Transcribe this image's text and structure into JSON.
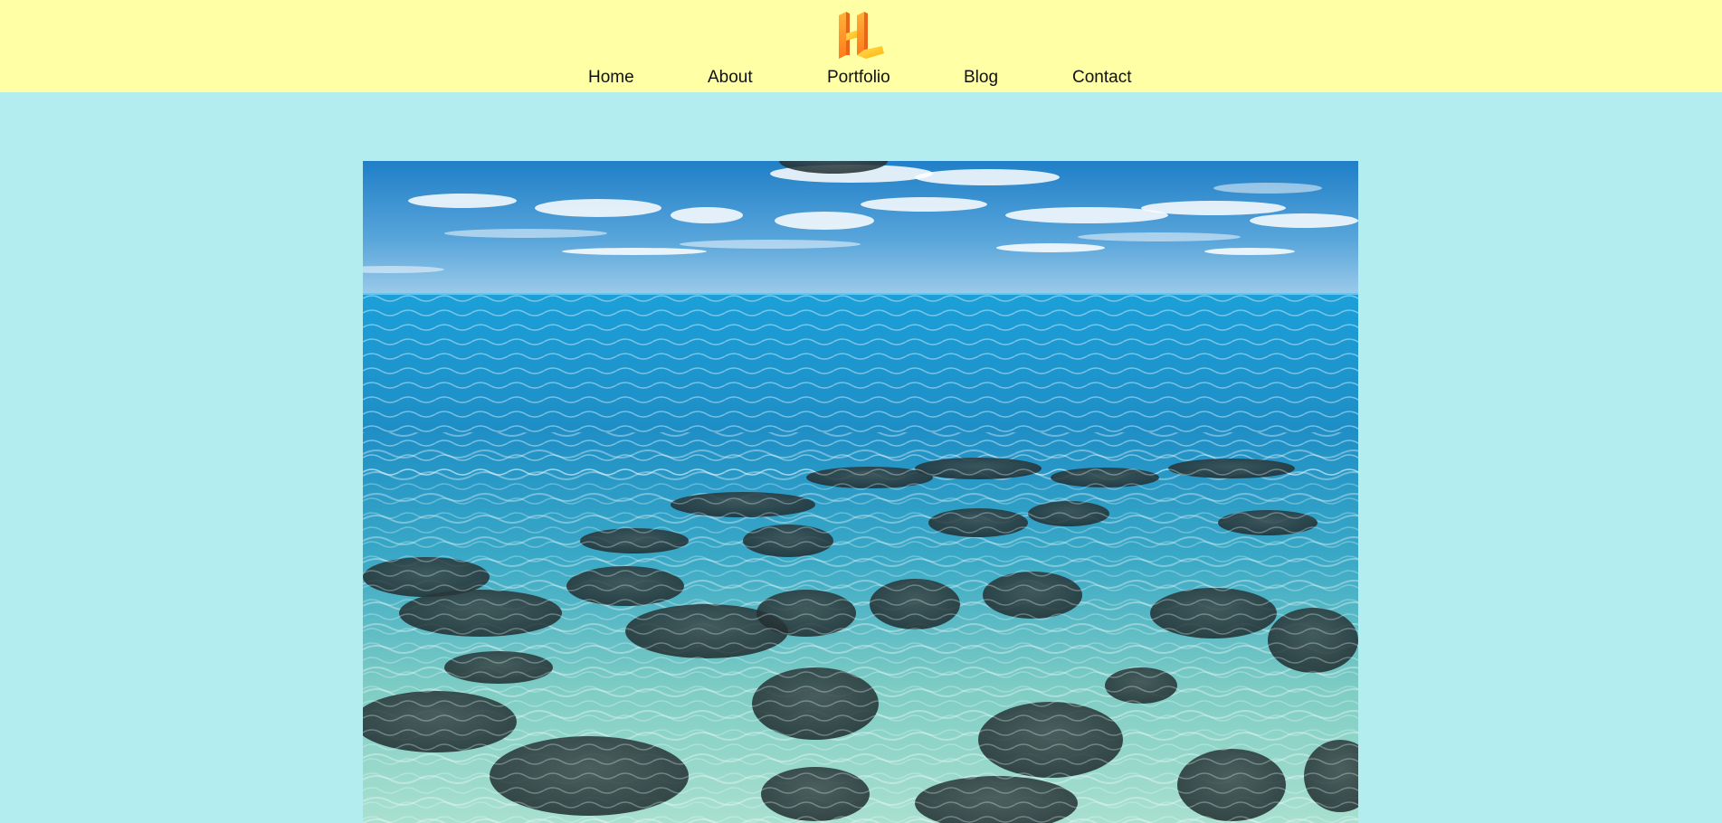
{
  "header": {
    "logo_icon": "hl-logo-icon",
    "background": "#ffffa6"
  },
  "nav": {
    "items": [
      {
        "label": "Home"
      },
      {
        "label": "About"
      },
      {
        "label": "Portfolio"
      },
      {
        "label": "Blog"
      },
      {
        "label": "Contact"
      }
    ]
  },
  "page": {
    "background": "#b3edf0"
  },
  "hero": {
    "image_icon": "ocean-reef-image"
  }
}
